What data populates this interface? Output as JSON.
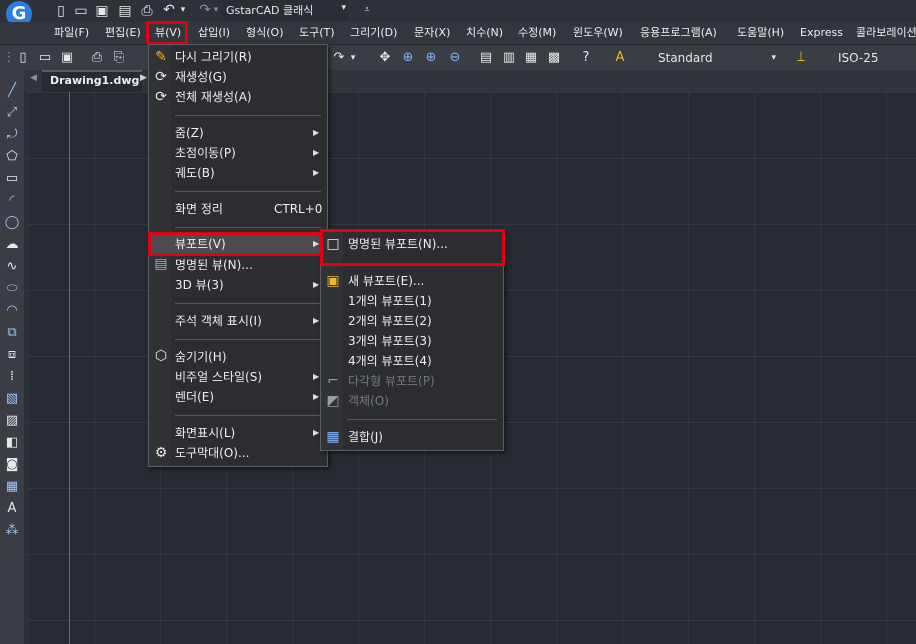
{
  "app": {
    "title": "GstarCAD 클래식",
    "brand_color": "#2b7de1"
  },
  "menubar": [
    "파일(F)",
    "편집(E)",
    "뷰(V)",
    "삽입(I)",
    "형식(O)",
    "도구(T)",
    "그리기(D)",
    "문자(X)",
    "치수(N)",
    "수정(M)",
    "윈도우(W)",
    "응용프로그램(A)",
    "도움말(H)",
    "Express",
    "콜라보레이션"
  ],
  "toolbar": {
    "textstyle": "Standard",
    "dimstyle": "ISO-25"
  },
  "tab": {
    "label": "Drawing1.dwg"
  },
  "view_menu": {
    "redraw": "다시 그리기(R)",
    "regen": "재생성(G)",
    "regen_all": "전체 재생성(A)",
    "zoom": "줌(Z)",
    "pan": "초점이동(P)",
    "orbit": "궤도(B)",
    "clean_screen": "화면 정리",
    "clean_screen_shortcut": "CTRL+0",
    "viewports": "뷰포트(V)",
    "named_views": "명명된 뷰(N)...",
    "view_3d": "3D 뷰(3)",
    "annotation_display": "주석 객체 표시(I)",
    "hide": "숨기기(H)",
    "visual_styles": "비주얼 스타일(S)",
    "render": "렌더(E)",
    "display": "화면표시(L)",
    "toolbars": "도구막대(O)..."
  },
  "viewport_submenu": {
    "named_viewports": "명명된 뷰포트(N)...",
    "new_viewports": "새 뷰포트(E)...",
    "vp1": "1개의 뷰포트(1)",
    "vp2": "2개의 뷰포트(2)",
    "vp3": "3개의 뷰포트(3)",
    "vp4": "4개의 뷰포트(4)",
    "polygonal": "다각형 뷰포트(P)",
    "object": "객체(O)",
    "join": "결합(J)"
  },
  "colors": {
    "highlight": "#e3000f",
    "menu_bg": "#2b2d31",
    "selected_bg": "#4a4c51"
  }
}
